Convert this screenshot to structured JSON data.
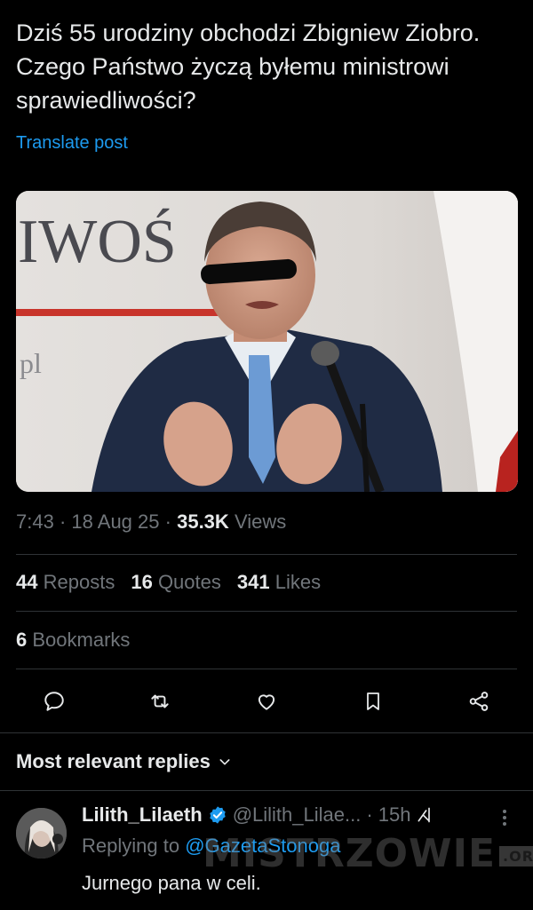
{
  "post": {
    "text": "Dziś 55 urodziny obchodzi Zbigniew Ziobro.  Czego Państwo życzą byłemu ministrowi sprawiedliwości?",
    "translate_label": "Translate post",
    "image": {
      "background_text": "IWOŚ",
      "background_small_text": "pl"
    },
    "time": "7:43",
    "date": "18 Aug 25",
    "views_count": "35.3K",
    "views_label": "Views",
    "separator": "·"
  },
  "stats": {
    "reposts_count": "44",
    "reposts_label": "Reposts",
    "quotes_count": "16",
    "quotes_label": "Quotes",
    "likes_count": "341",
    "likes_label": "Likes",
    "bookmarks_count": "6",
    "bookmarks_label": "Bookmarks"
  },
  "actions": [
    "reply-icon",
    "repost-icon",
    "like-icon",
    "bookmark-icon",
    "share-icon"
  ],
  "replies": {
    "header": "Most relevant replies",
    "items": [
      {
        "name": "Lilith_Lilaeth",
        "handle": "@Lilith_Lilae...",
        "time": "· 15h",
        "replying_prefix": "Replying to",
        "replying_to": "@GazetaStonoga",
        "text": "Jurnego pana w celi."
      }
    ]
  },
  "watermark": {
    "text": "MISTRZOWIE",
    "suffix": ".ORG"
  },
  "colors": {
    "background": "#000000",
    "text": "#e7e9ea",
    "secondary": "#71767b",
    "accent": "#1d9bf0",
    "divider": "#2f3336"
  }
}
